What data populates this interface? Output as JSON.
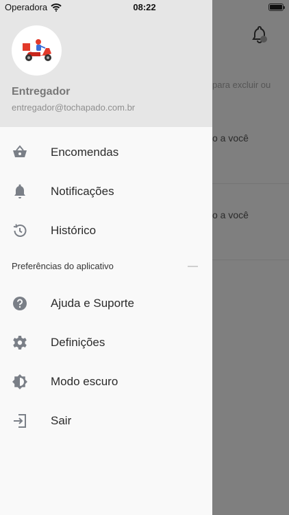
{
  "status_bar": {
    "carrier": "Operadora",
    "time": "08:22"
  },
  "background": {
    "hint_text": "para excluir ou",
    "row1_text": "o a você",
    "row2_text": "o a você",
    "bell_icon": "bell-icon"
  },
  "drawer": {
    "user": {
      "name": "Entregador",
      "email": "entregador@tochapado.com.br"
    },
    "items": [
      {
        "label": "Encomendas",
        "icon": "basket-icon"
      },
      {
        "label": "Notificações",
        "icon": "bell-icon"
      },
      {
        "label": "Histórico",
        "icon": "history-icon"
      }
    ],
    "section_title": "Preferências do aplicativo",
    "pref_items": [
      {
        "label": "Ajuda e Suporte",
        "icon": "help-icon"
      },
      {
        "label": "Definições",
        "icon": "gear-icon"
      },
      {
        "label": "Modo escuro",
        "icon": "brightness-icon"
      },
      {
        "label": "Sair",
        "icon": "logout-icon"
      }
    ]
  },
  "colors": {
    "drawer_bg": "#f9f9f9",
    "header_bg": "#e6e6e6",
    "icon_gray": "#7a7f87",
    "overlay": "#7f7f7f",
    "scooter_red": "#e23a2a"
  }
}
